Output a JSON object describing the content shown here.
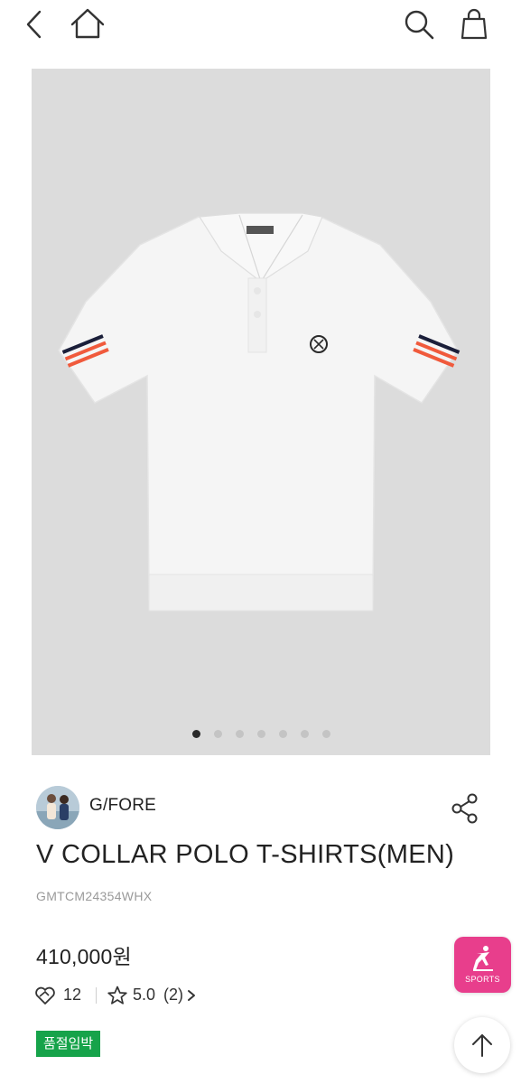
{
  "header": {
    "icons": [
      "back-arrow-icon",
      "home-icon",
      "search-icon",
      "shopping-bag-icon"
    ]
  },
  "gallery": {
    "image_subject": "white polo t-shirt with striped cuffs",
    "slide_count": 7,
    "active_slide": 1,
    "background": "#dcdcdc"
  },
  "brand": {
    "name": "G/FORE",
    "share_icon": "share-icon"
  },
  "product": {
    "title": "V COLLAR POLO T-SHIRTS(MEN)",
    "code": "GMTCM24354WHX",
    "price": "410,000원"
  },
  "stats": {
    "likes": "12",
    "rating": "5.0",
    "review_count": "(2)"
  },
  "badge": {
    "label": "품절임박",
    "color": "#16a34a"
  },
  "floating": {
    "sports_label": "SPORTS",
    "sports_color": "#e83e8c",
    "top_icon": "arrow-up-icon"
  }
}
